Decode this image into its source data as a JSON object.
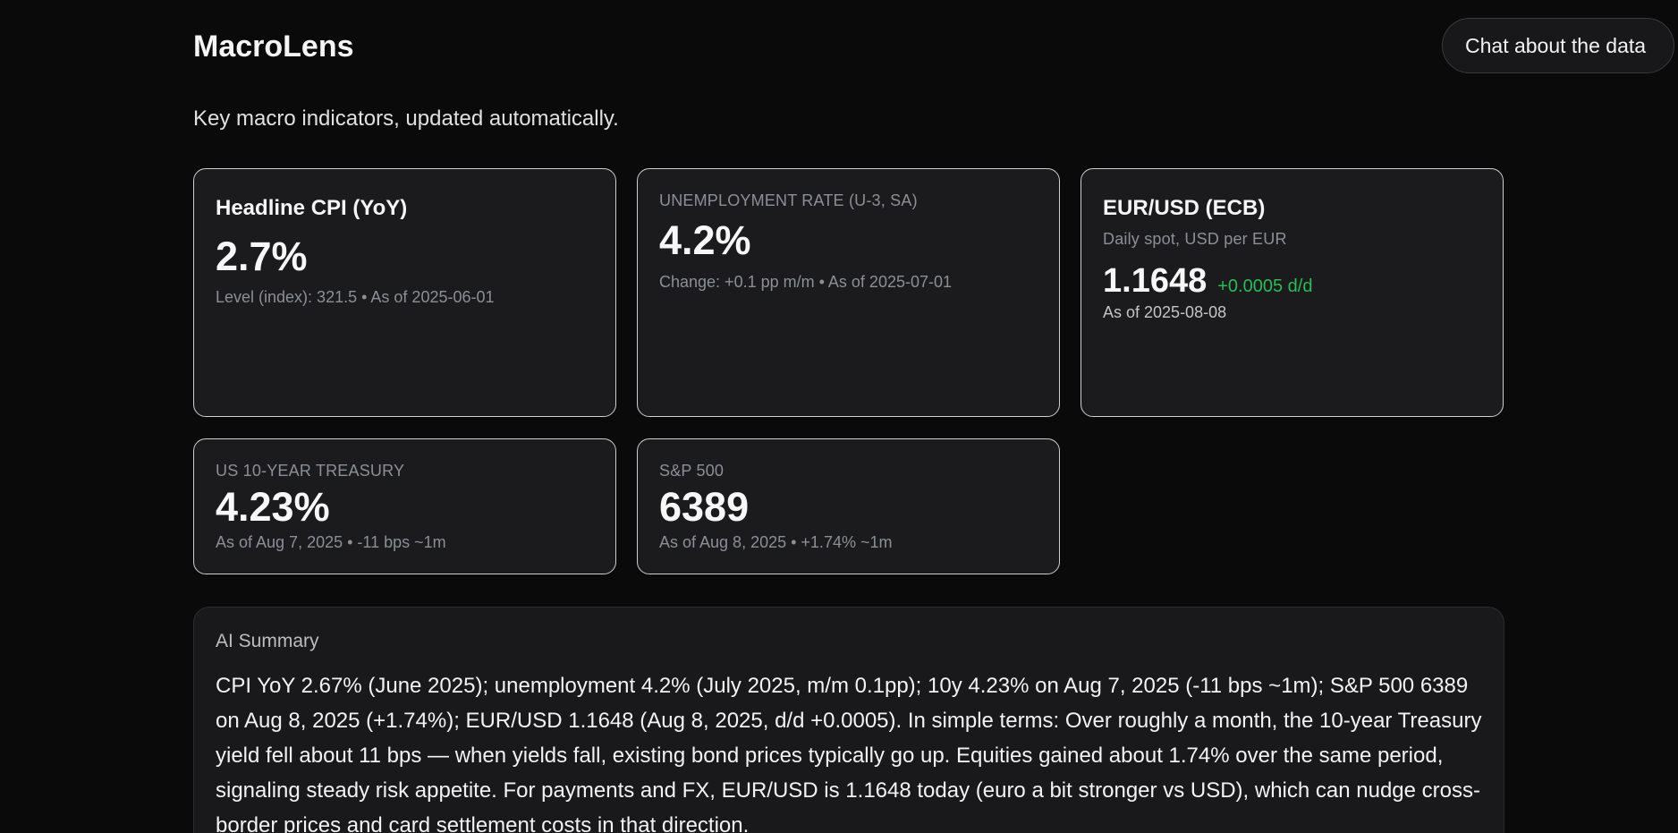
{
  "app": {
    "title": "MacroLens",
    "subtitle": "Key macro indicators, updated automatically."
  },
  "header": {
    "chat_button_label": "Chat about the data"
  },
  "cards": {
    "cpi": {
      "heading": "Headline CPI (YoY)",
      "value": "2.7%",
      "meta": "Level (index): 321.5 • As of 2025-06-01"
    },
    "unemployment": {
      "label": "UNEMPLOYMENT RATE (U-3, SA)",
      "value": "4.2%",
      "meta": "Change: +0.1 pp m/m • As of 2025-07-01"
    },
    "eurusd": {
      "heading": "EUR/USD (ECB)",
      "subheading": "Daily spot, USD per EUR",
      "value": "1.1648",
      "change": "+0.0005 d/d",
      "as_of": "As of 2025-08-08"
    },
    "treasury": {
      "label": "US 10-YEAR TREASURY",
      "value": "4.23%",
      "meta": "As of Aug 7, 2025 • -11 bps ~1m"
    },
    "sp500": {
      "label": "S&P 500",
      "value": "6389",
      "meta": "As of Aug 8, 2025 • +1.74% ~1m"
    }
  },
  "summary": {
    "title": "AI Summary",
    "text": "CPI YoY 2.67% (June 2025); unemployment 4.2% (July 2025, m/m 0.1pp); 10y 4.23% on Aug 7, 2025 (-11 bps ~1m); S&P 500 6389 on Aug 8, 2025 (+1.74%); EUR/USD 1.1648 (Aug 8, 2025, d/d +0.0005). In simple terms: Over roughly a month, the 10-year Treasury yield fell about 11 bps — when yields fall, existing bond prices typically go up. Equities gained about 1.74% over the same period, signaling steady risk appetite. For payments and FX, EUR/USD is 1.1648 today (euro a bit stronger vs USD), which can nudge cross-border prices and card settlement costs in that direction."
  },
  "colors": {
    "background": "#0a0a0a",
    "card_background": "#1b1b1d",
    "positive_change": "#2bbb58",
    "muted_text": "#8a8f98"
  }
}
